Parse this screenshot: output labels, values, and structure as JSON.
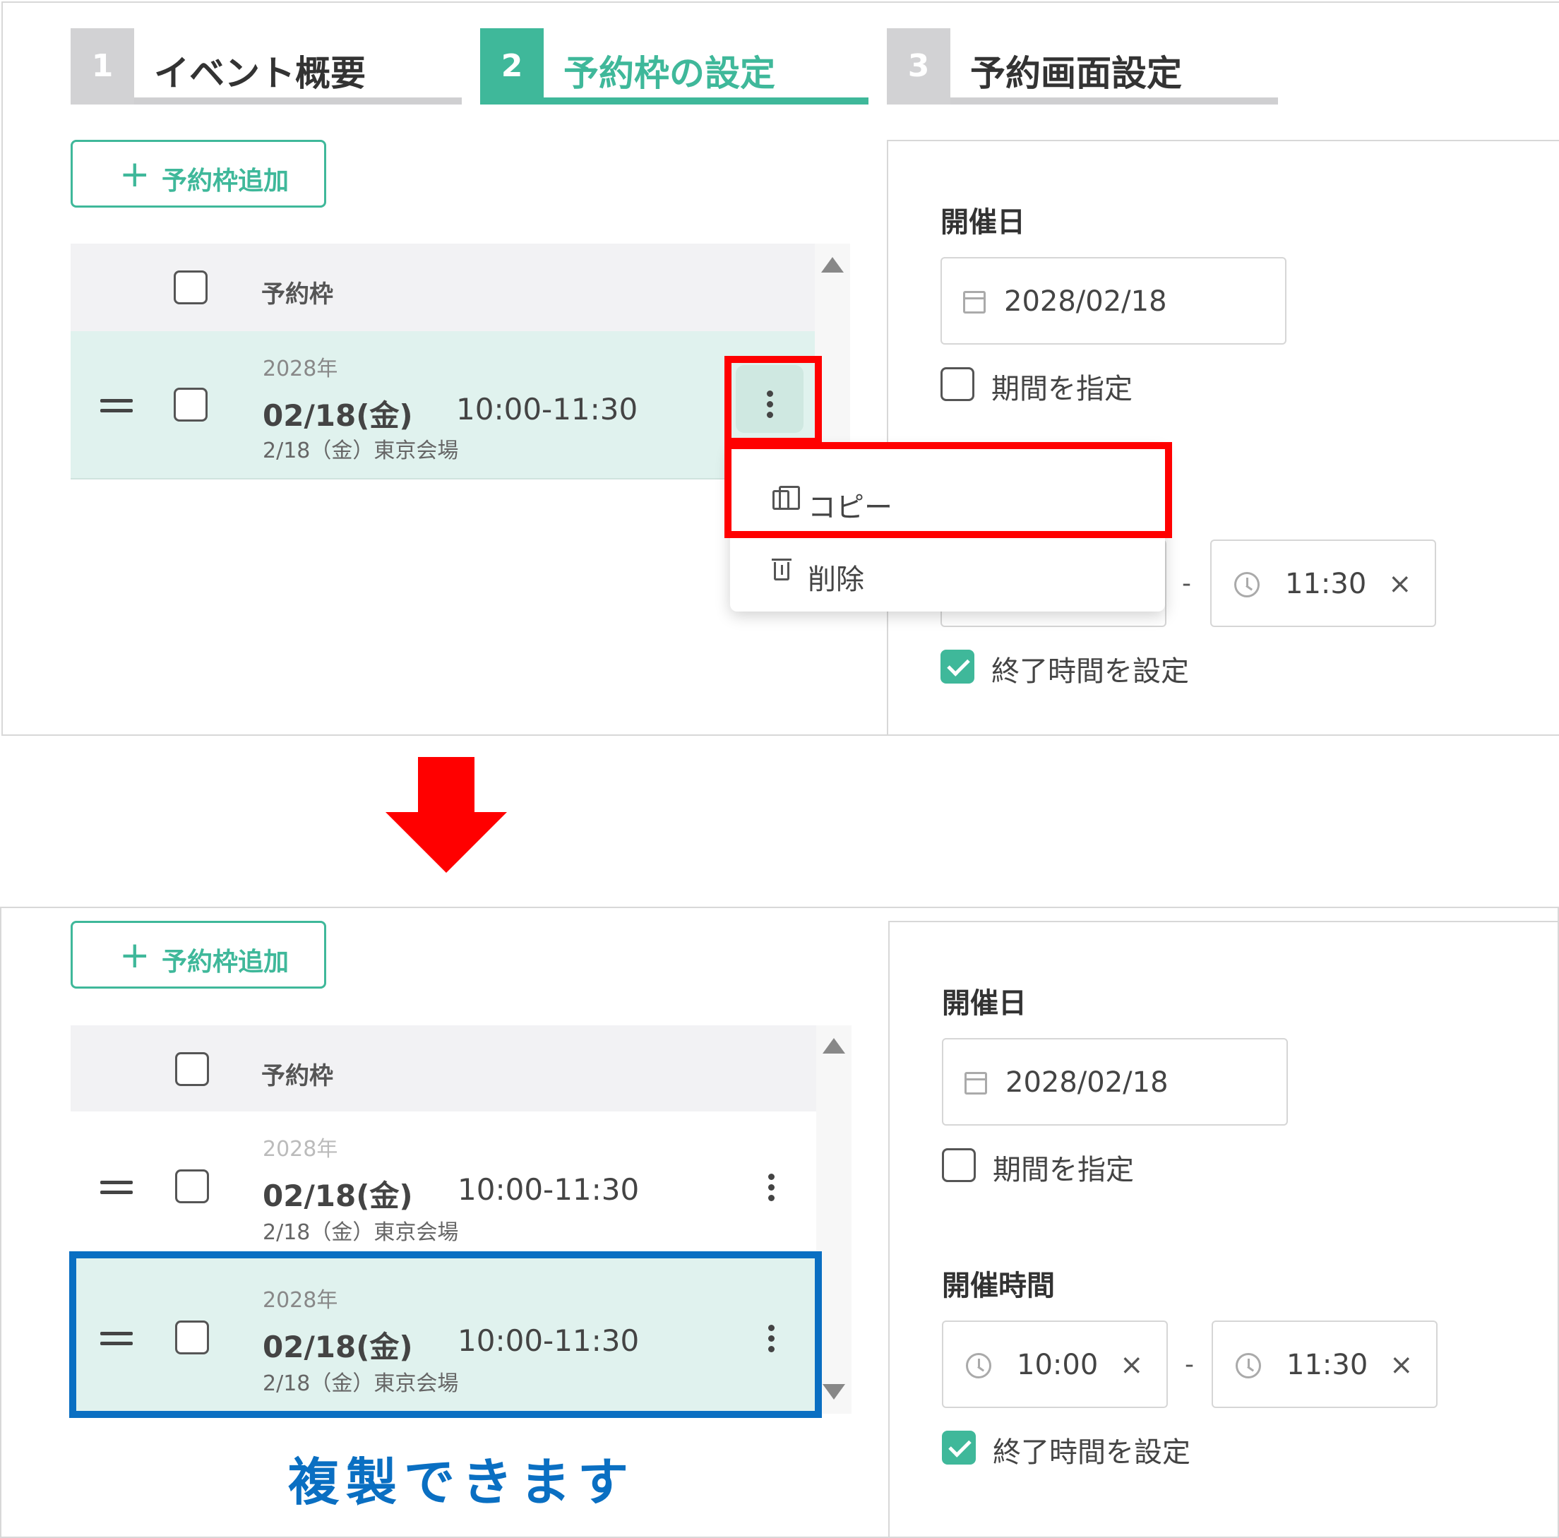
{
  "steps": [
    {
      "num": "1",
      "label": "イベント概要"
    },
    {
      "num": "2",
      "label": "予約枠の設定"
    },
    {
      "num": "3",
      "label": "予約画面設定"
    }
  ],
  "add_button_label": "予約枠追加",
  "table_header": "予約枠",
  "slot": {
    "year": "2028年",
    "date": "02/18(金)",
    "time": "10:00-11:30",
    "venue": "2/18（金）東京会場"
  },
  "context_menu": {
    "copy": "コピー",
    "delete": "削除"
  },
  "form": {
    "date_label": "開催日",
    "date_value": "2028/02/18",
    "period_label": "期間を指定",
    "time_label": "開催時間",
    "start_time": "10:00",
    "end_time": "11:30",
    "dash": "-",
    "clear": "×",
    "end_time_toggle_label": "終了時間を設定"
  },
  "caption": "複製できます",
  "colors": {
    "accent": "#3fb89a",
    "highlight_red": "#ff0000",
    "highlight_blue": "#0a6fc2",
    "selected_row": "#e0f2ee"
  }
}
